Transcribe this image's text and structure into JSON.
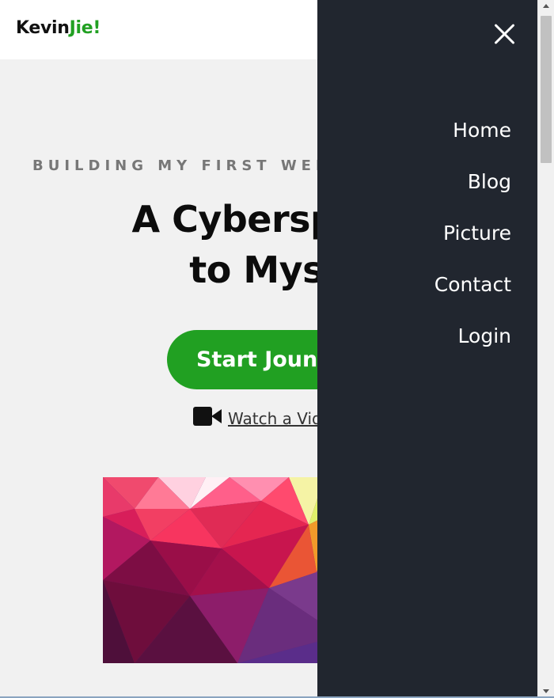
{
  "header": {
    "logo_main": "Kevin",
    "logo_accent": "Jie!",
    "accent_color": "#21a022"
  },
  "hero": {
    "subtitle": "BUILDING MY FIRST WEB",
    "title_line1": "A Cyberspace",
    "title_line2": "to Myse",
    "cta_label": "Start Jouney",
    "video_icon": "video-camera-icon",
    "video_link_label": "Watch a Video"
  },
  "drawer": {
    "background": "#21262f",
    "close_icon": "close-icon",
    "menu": [
      {
        "label": "Home"
      },
      {
        "label": "Blog"
      },
      {
        "label": "Picture"
      },
      {
        "label": "Contact"
      },
      {
        "label": "Login"
      }
    ]
  }
}
